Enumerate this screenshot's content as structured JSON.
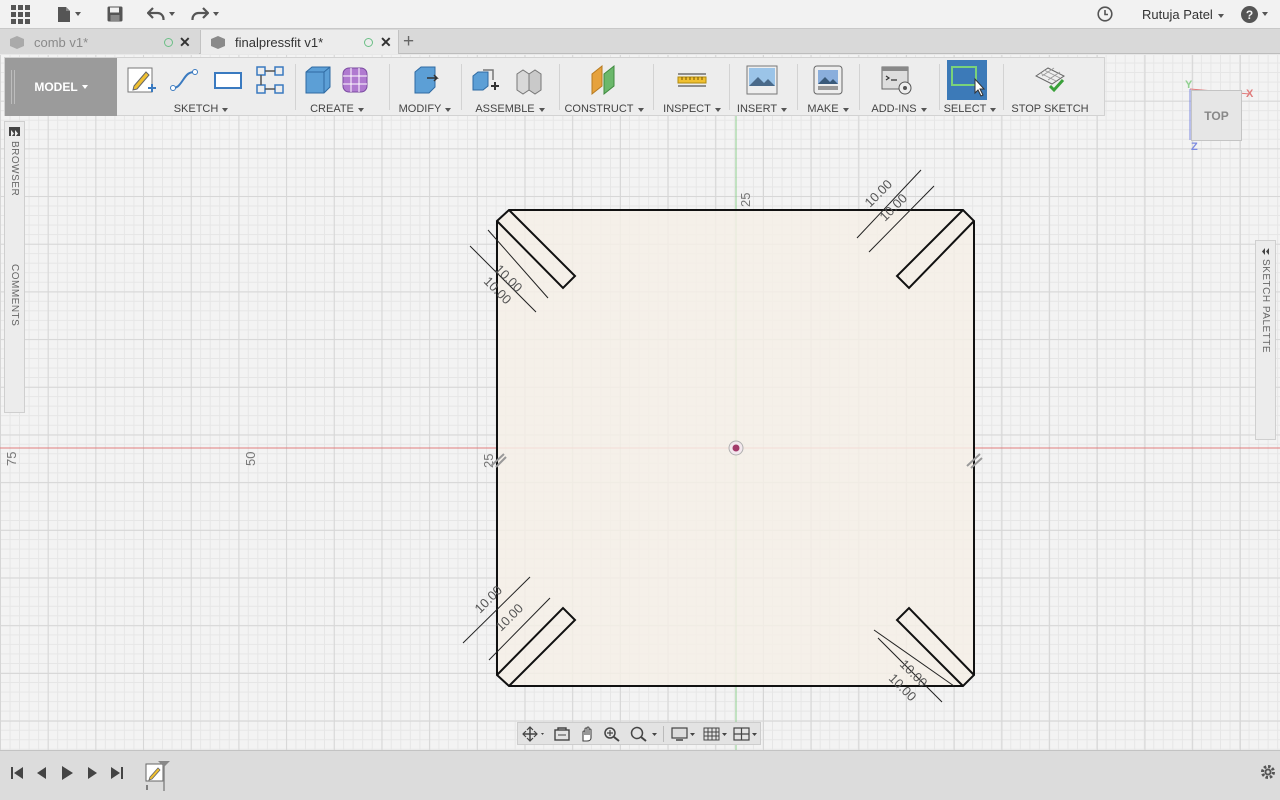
{
  "app_bar": {
    "user_name": "Rutuja Patel",
    "icons": [
      "apps-grid-icon",
      "file-icon",
      "save-icon",
      "undo-icon",
      "redo-icon",
      "clock-icon",
      "help-icon"
    ]
  },
  "tabs": [
    {
      "label": "comb v1*",
      "active": false
    },
    {
      "label": "finalpressfit v1*",
      "active": true
    }
  ],
  "toolbar": {
    "workspace_label": "MODEL",
    "groups": [
      {
        "id": "sketch",
        "label": "SKETCH"
      },
      {
        "id": "create",
        "label": "CREATE"
      },
      {
        "id": "modify",
        "label": "MODIFY"
      },
      {
        "id": "assemble",
        "label": "ASSEMBLE"
      },
      {
        "id": "construct",
        "label": "CONSTRUCT"
      },
      {
        "id": "inspect",
        "label": "INSPECT"
      },
      {
        "id": "insert",
        "label": "INSERT"
      },
      {
        "id": "make",
        "label": "MAKE"
      },
      {
        "id": "addins",
        "label": "ADD-INS"
      },
      {
        "id": "select",
        "label": "SELECT"
      },
      {
        "id": "stop",
        "label": "STOP SKETCH"
      }
    ]
  },
  "panels": {
    "browser": "BROWSER",
    "comments": "COMMENTS",
    "sketch_palette": "SKETCH PALETTE"
  },
  "viewcube": {
    "face": "TOP",
    "axis_x": "X",
    "axis_y": "Y",
    "axis_z": "Z"
  },
  "sketch": {
    "dimension_value": "10.00",
    "axis_labels": {
      "top": "25",
      "left_75": "75",
      "left_50": "50",
      "left_25": "25"
    }
  },
  "colors": {
    "accent_select": "#3c7ab8",
    "x_axis": "#e07c7c",
    "y_axis": "#8fd08f",
    "profile_fill": "#f5efe6"
  }
}
